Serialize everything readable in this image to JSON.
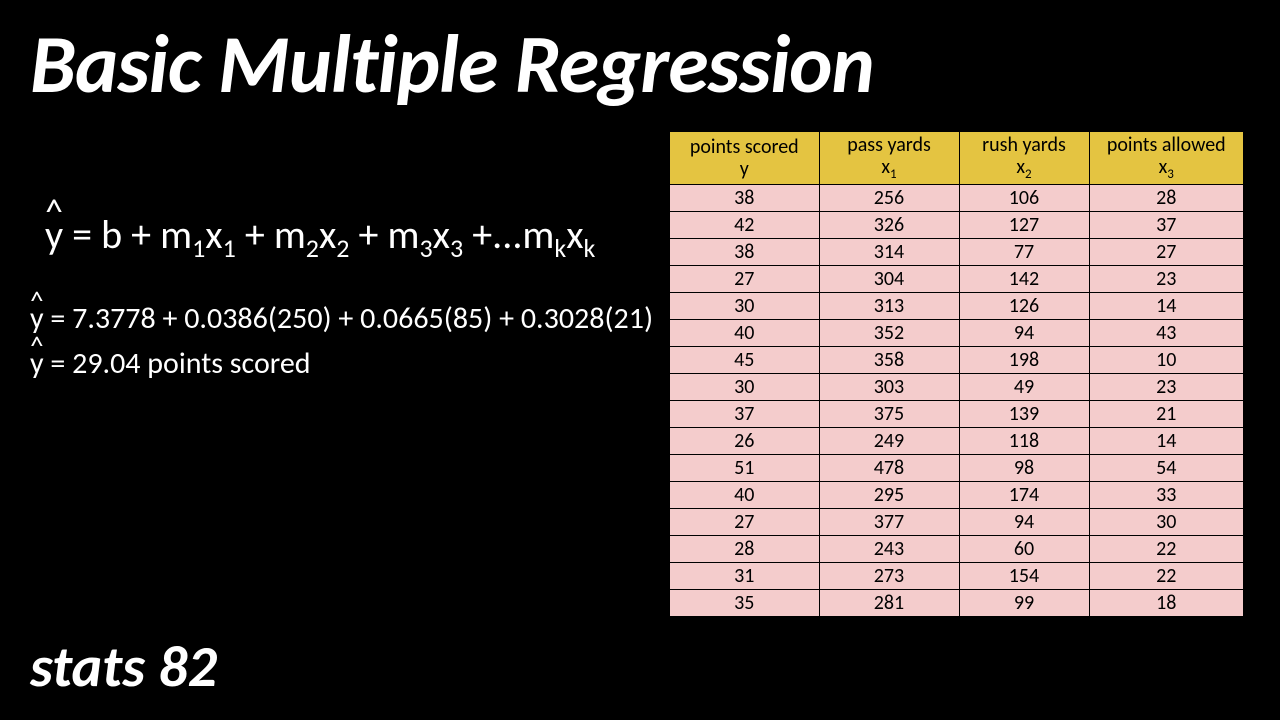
{
  "title": "Basic Multiple Regression",
  "equation_general": {
    "lhs": "y",
    "rhs_parts": [
      "= b + m",
      "x",
      " + m",
      "x",
      " + m",
      "x",
      " +...m",
      "x"
    ]
  },
  "equation_filled": "= 7.3778 + 0.0386(250) + 0.0665(85) + 0.3028(21)",
  "equation_result": "= 29.04 points scored",
  "footer": "stats 82",
  "table": {
    "headers": [
      {
        "label": "points scored",
        "var": "y"
      },
      {
        "label": "pass yards",
        "var": "x1"
      },
      {
        "label": "rush yards",
        "var": "x2"
      },
      {
        "label": "points allowed",
        "var": "x3"
      }
    ],
    "rows": [
      [
        38,
        256,
        106,
        28
      ],
      [
        42,
        326,
        127,
        37
      ],
      [
        38,
        314,
        77,
        27
      ],
      [
        27,
        304,
        142,
        23
      ],
      [
        30,
        313,
        126,
        14
      ],
      [
        40,
        352,
        94,
        43
      ],
      [
        45,
        358,
        198,
        10
      ],
      [
        30,
        303,
        49,
        23
      ],
      [
        37,
        375,
        139,
        21
      ],
      [
        26,
        249,
        118,
        14
      ],
      [
        51,
        478,
        98,
        54
      ],
      [
        40,
        295,
        174,
        33
      ],
      [
        27,
        377,
        94,
        30
      ],
      [
        28,
        243,
        60,
        22
      ],
      [
        31,
        273,
        154,
        22
      ],
      [
        35,
        281,
        99,
        18
      ]
    ]
  },
  "chart_data": {
    "type": "table",
    "title": "Multiple Regression Data",
    "columns": [
      "points scored (y)",
      "pass yards (x1)",
      "rush yards (x2)",
      "points allowed (x3)"
    ],
    "rows": [
      [
        38,
        256,
        106,
        28
      ],
      [
        42,
        326,
        127,
        37
      ],
      [
        38,
        314,
        77,
        27
      ],
      [
        27,
        304,
        142,
        23
      ],
      [
        30,
        313,
        126,
        14
      ],
      [
        40,
        352,
        94,
        43
      ],
      [
        45,
        358,
        198,
        10
      ],
      [
        30,
        303,
        49,
        23
      ],
      [
        37,
        375,
        139,
        21
      ],
      [
        26,
        249,
        118,
        14
      ],
      [
        51,
        478,
        98,
        54
      ],
      [
        40,
        295,
        174,
        33
      ],
      [
        27,
        377,
        94,
        30
      ],
      [
        28,
        243,
        60,
        22
      ],
      [
        31,
        273,
        154,
        22
      ],
      [
        35,
        281,
        99,
        18
      ]
    ],
    "model": {
      "intercept": 7.3778,
      "coefficients": [
        0.0386,
        0.0665,
        0.3028
      ],
      "example_input": [
        250,
        85,
        21
      ],
      "predicted": 29.04
    }
  }
}
